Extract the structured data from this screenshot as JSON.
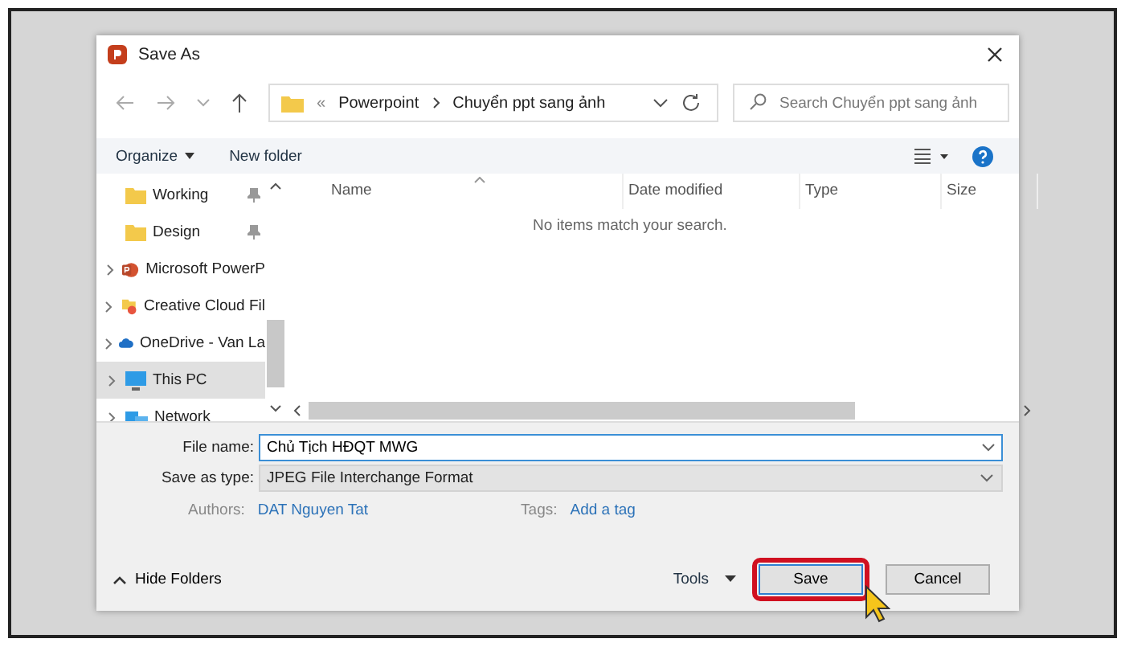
{
  "window": {
    "title": "Save As"
  },
  "address_bar": {
    "overflow_mark": "«",
    "path": [
      "Powerpoint",
      "Chuyển ppt sang ảnh"
    ]
  },
  "search": {
    "placeholder": "Search Chuyển ppt sang ảnh"
  },
  "toolbar": {
    "organize": "Organize",
    "new_folder": "New folder"
  },
  "sidebar": {
    "items": [
      {
        "label": "Working",
        "kind": "folder",
        "pinned": true,
        "expandable": false,
        "selected": false
      },
      {
        "label": "Design",
        "kind": "folder",
        "pinned": true,
        "expandable": false,
        "selected": false
      },
      {
        "label": "Microsoft PowerP",
        "kind": "app",
        "pinned": false,
        "expandable": true,
        "selected": false
      },
      {
        "label": "Creative Cloud Fil",
        "kind": "synced-folder",
        "pinned": false,
        "expandable": true,
        "selected": false
      },
      {
        "label": "OneDrive - Van La",
        "kind": "cloud",
        "pinned": false,
        "expandable": true,
        "selected": false
      },
      {
        "label": "This PC",
        "kind": "computer",
        "pinned": false,
        "expandable": true,
        "selected": true
      },
      {
        "label": "Network",
        "kind": "network",
        "pinned": false,
        "expandable": true,
        "selected": false
      }
    ]
  },
  "file_list": {
    "columns": [
      {
        "label": "Name",
        "sorted": true
      },
      {
        "label": "Date modified",
        "sorted": false
      },
      {
        "label": "Type",
        "sorted": false
      },
      {
        "label": "Size",
        "sorted": false
      }
    ],
    "empty_message": "No items match your search."
  },
  "form": {
    "fields": [
      {
        "label": "File name:",
        "value": "Chủ Tịch HĐQT MWG",
        "kind": "text"
      },
      {
        "label": "Save as type:",
        "value": "JPEG File Interchange Format",
        "kind": "select"
      }
    ],
    "meta": [
      {
        "label": "Authors:",
        "value": "DAT Nguyen Tat"
      },
      {
        "label": "Tags:",
        "value": "Add a tag"
      }
    ]
  },
  "footer": {
    "hide_folders": "Hide Folders",
    "tools": "Tools",
    "buttons": [
      {
        "label": "Save",
        "kind": "primary",
        "highlighted": true
      },
      {
        "label": "Cancel",
        "kind": "secondary",
        "highlighted": false
      }
    ]
  }
}
